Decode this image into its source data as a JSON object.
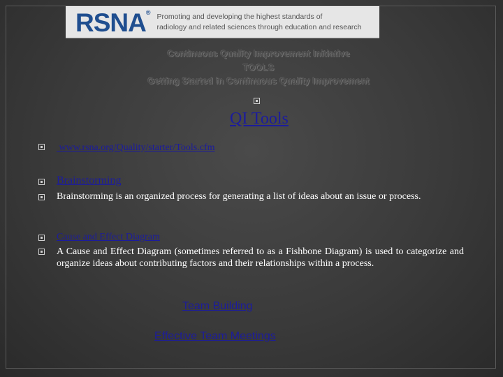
{
  "logo": {
    "wordmark": "RSNA",
    "reg_mark": "®",
    "tagline_line1": "Promoting and developing the highest standards of",
    "tagline_line2": "radiology and related sciences through education and research"
  },
  "header": {
    "line1": "Continuous Quality Improvement Initiative",
    "line2": "TOOLS",
    "line3": "Getting Started in Continuous Quality Improvement"
  },
  "title": "QI Tools",
  "url_link": " www.rsna.org/Quality/starter/Tools.cfm",
  "brainstorming": {
    "heading": "Brainstorming",
    "description": "Brainstorming is an organized process for generating a list of ideas about an issue or process."
  },
  "cause_effect": {
    "heading": "Cause and Effect Diagram",
    "description": "A Cause and Effect Diagram (sometimes referred to as a Fishbone Diagram) is used to categorize and organize ideas about contributing factors and their relationships within a process."
  },
  "links": {
    "team_building": "Team Building",
    "effective_meetings": "Effective Team Meetings"
  },
  "colors": {
    "background": "#3a3a3a",
    "link": "#1c1c9c",
    "logo_blue": "#1f4e8f"
  }
}
